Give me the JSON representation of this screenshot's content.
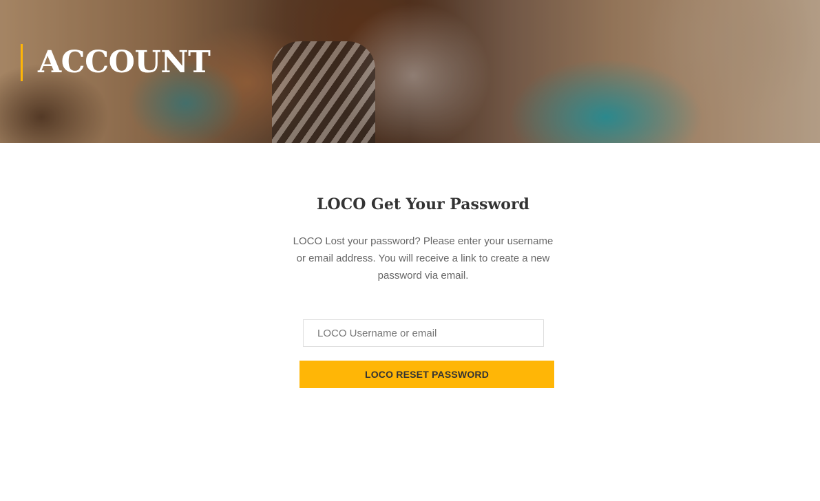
{
  "header": {
    "title": "ACCOUNT",
    "accent_color": "#ffb606"
  },
  "form": {
    "heading": "LOCO Get Your Password",
    "description": "LOCO Lost your password? Please enter your username or email address. You will receive a link to create a new password via email.",
    "username_placeholder": "LOCO Username or email",
    "username_value": "",
    "submit_label": "LOCO RESET PASSWORD",
    "button_color": "#ffb606"
  }
}
